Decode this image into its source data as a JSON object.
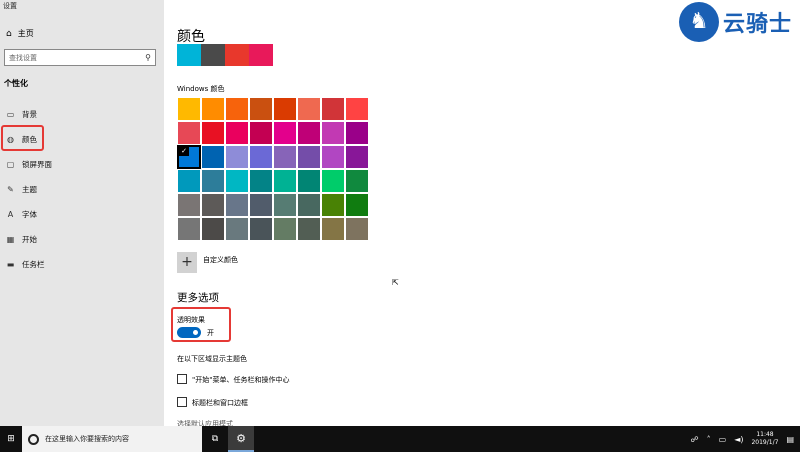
{
  "window": {
    "title": "设置"
  },
  "sidebar": {
    "home_label": "主页",
    "search_placeholder": "查找设置",
    "section_title": "个性化",
    "items": [
      {
        "label": "背景",
        "icon": "image-icon"
      },
      {
        "label": "颜色",
        "icon": "palette-icon"
      },
      {
        "label": "锁屏界面",
        "icon": "lock-screen-icon"
      },
      {
        "label": "主题",
        "icon": "brush-icon"
      },
      {
        "label": "字体",
        "icon": "font-icon"
      },
      {
        "label": "开始",
        "icon": "start-icon"
      },
      {
        "label": "任务栏",
        "icon": "taskbar-icon"
      }
    ],
    "selected": "颜色"
  },
  "main": {
    "title": "颜色",
    "recent_colors": [
      "#00b4d8",
      "#4a4a4a",
      "#e8382c",
      "#e8195a"
    ],
    "windows_colors_label": "Windows 颜色",
    "palette": [
      [
        "#ffb900",
        "#ff8c00",
        "#f7630c",
        "#ca5010",
        "#da3b01",
        "#ef6950",
        "#d13438",
        "#ff4343"
      ],
      [
        "#e74856",
        "#e81123",
        "#ea005e",
        "#c30052",
        "#e3008c",
        "#bf0077",
        "#c239b3",
        "#9a0089"
      ],
      [
        "#0078d7",
        "#0063b1",
        "#8e8cd8",
        "#6b69d6",
        "#8764b8",
        "#744da9",
        "#b146c2",
        "#881798"
      ],
      [
        "#0099bc",
        "#2d7d9a",
        "#00b7c3",
        "#038387",
        "#00b294",
        "#018574",
        "#00cc6a",
        "#10893e"
      ],
      [
        "#7a7574",
        "#5d5a58",
        "#68768a",
        "#515c6b",
        "#567c73",
        "#486860",
        "#498205",
        "#107c10"
      ],
      [
        "#767676",
        "#4c4a48",
        "#69797e",
        "#4a5459",
        "#647c64",
        "#525e54",
        "#847545",
        "#7e735f"
      ]
    ],
    "selected_color_index": [
      2,
      0
    ],
    "custom_color_button": "+",
    "custom_color_label": "自定义颜色",
    "more_options_title": "更多选项",
    "transparency_label": "透明效果",
    "transparency_state": "开",
    "show_accent_label": "在以下区域显示主题色",
    "checkbox_start": "\"开始\"菜单、任务栏和操作中心",
    "checkbox_titlebar": "标题栏和窗口边框",
    "cut_text": "选择默认应用模式"
  },
  "watermark": {
    "text": "云骑士",
    "color": "#1a5fb4"
  },
  "taskbar": {
    "search_placeholder": "在这里输入你要搜索的内容",
    "time": "11:48",
    "date": "2019/1/7"
  }
}
